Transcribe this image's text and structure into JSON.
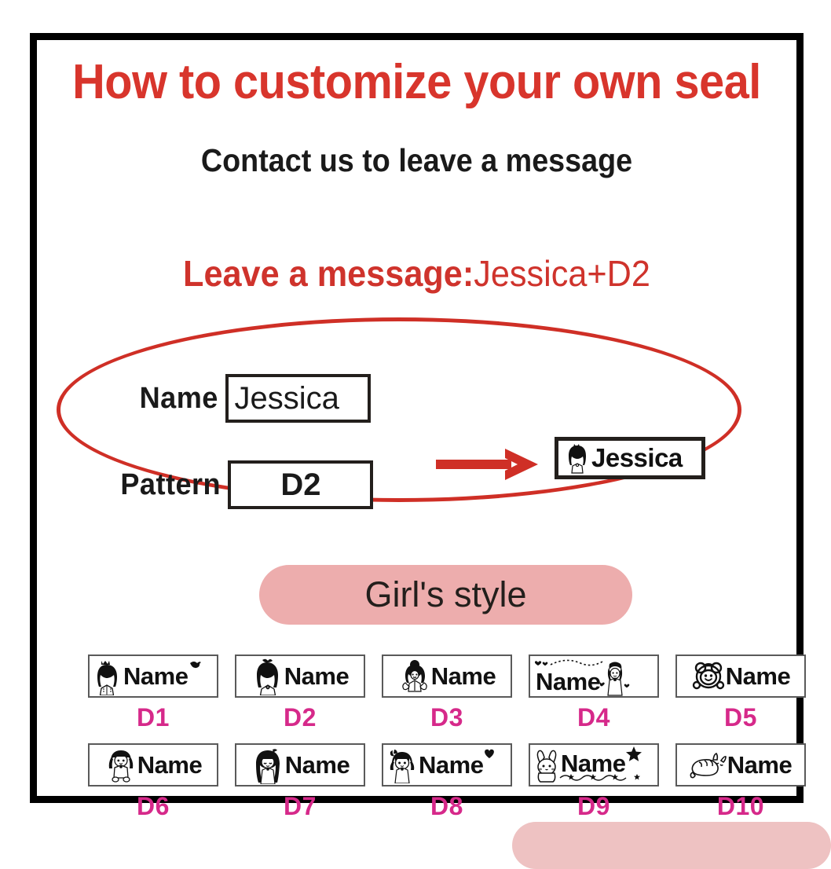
{
  "poster": {
    "title": "How to customize your own seal",
    "subtitle": "Contact us to leave a message",
    "leave_message_label": "Leave a message:",
    "leave_message_value": "Jessica+D2",
    "accent_red": "#cf332c",
    "title_red": "#d8352c",
    "pink_pill": "#edadad",
    "code_pink": "#d6298a",
    "frame_black": "#000000"
  },
  "example": {
    "name_label": "Name",
    "name_value": "Jessica",
    "pattern_label": "Pattern",
    "pattern_value": "D2",
    "arrow_icon": "right-arrow-icon",
    "result_icon": "girl-d2-icon",
    "result_text": "Jessica"
  },
  "style_section": {
    "pill_label": "Girl's style"
  },
  "patterns": {
    "sample_word": "Name",
    "rows": [
      [
        {
          "code": "D1",
          "icon": "princess-crown-girl-icon",
          "word": "Name"
        },
        {
          "code": "D2",
          "icon": "girl-bow-hair-icon",
          "word": "Name"
        },
        {
          "code": "D3",
          "icon": "fairy-girl-icon",
          "word": "Name"
        },
        {
          "code": "D4",
          "icon": "princess-hearts-icon",
          "word": "Name"
        },
        {
          "code": "D5",
          "icon": "bear-hood-face-icon",
          "word": "Name"
        }
      ],
      [
        {
          "code": "D6",
          "icon": "girl-pigtails-icon",
          "word": "Name"
        },
        {
          "code": "D7",
          "icon": "long-hair-girl-icon",
          "word": "Name"
        },
        {
          "code": "D8",
          "icon": "girl-ribbon-icon",
          "word": "Name"
        },
        {
          "code": "D9",
          "icon": "bunny-star-icon",
          "word": "Name"
        },
        {
          "code": "D10",
          "icon": "sleeping-cat-icon",
          "word": "Name"
        }
      ]
    ]
  }
}
